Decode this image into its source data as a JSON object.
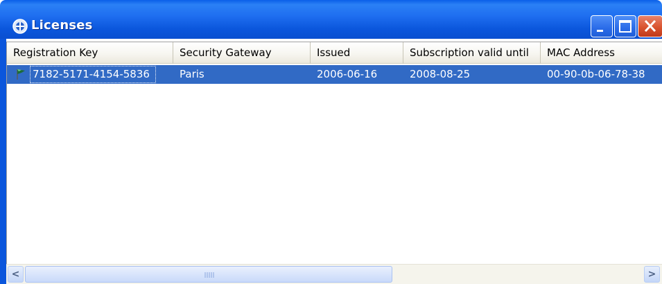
{
  "window": {
    "title": "Licenses",
    "controls": {
      "minimize_icon": "minimize-icon",
      "maximize_icon": "maximize-icon",
      "close_icon": "close-icon"
    }
  },
  "colors": {
    "titlebar": "#0b56dc",
    "selection": "#316ac5",
    "close_button": "#d9532e",
    "flag": "#1c6b3a"
  },
  "table": {
    "columns": [
      "Registration Key",
      "Security Gateway",
      "Issued",
      "Subscription valid until",
      "MAC Address"
    ],
    "rows": [
      {
        "icon": "flag-icon",
        "registration_key": "7182-5171-4154-5836",
        "security_gateway": "Paris",
        "issued": "2006-06-16",
        "valid_until": "2008-08-25",
        "mac_address": "00-90-0b-06-78-38",
        "selected": true
      }
    ]
  },
  "scrollbar": {
    "left_arrow": "<",
    "right_arrow": ">"
  }
}
